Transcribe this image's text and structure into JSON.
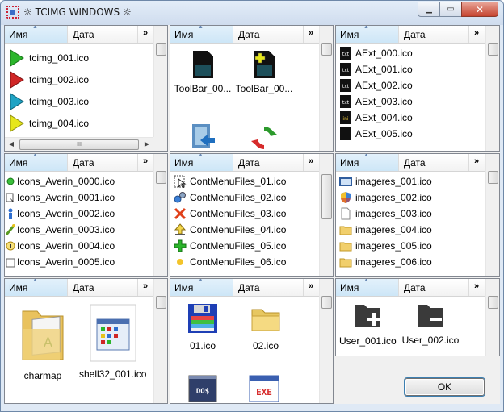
{
  "window": {
    "title": "☼ TCIMG WINDOWS ☼"
  },
  "header": {
    "name": "Имя",
    "date": "Дата",
    "more": "»"
  },
  "panes": {
    "p1": [
      "tcimg_001.ico",
      "tcimg_002.ico",
      "tcimg_003.ico",
      "tcimg_004.ico"
    ],
    "p2": [
      "ToolBar_00...",
      "ToolBar_00..."
    ],
    "p3": [
      "AExt_000.ico",
      "AExt_001.ico",
      "AExt_002.ico",
      "AExt_003.ico",
      "AExt_004.ico",
      "AExt_005.ico"
    ],
    "p4": [
      "Icons_Averin_0000.ico",
      "Icons_Averin_0001.ico",
      "Icons_Averin_0002.ico",
      "Icons_Averin_0003.ico",
      "Icons_Averin_0004.ico",
      "Icons_Averin_0005.ico"
    ],
    "p5": [
      "ContMenuFiles_01.ico",
      "ContMenuFiles_02.ico",
      "ContMenuFiles_03.ico",
      "ContMenuFiles_04.ico",
      "ContMenuFiles_05.ico",
      "ContMenuFiles_06.ico"
    ],
    "p6": [
      "imageres_001.ico",
      "imageres_002.ico",
      "imageres_003.ico",
      "imageres_004.ico",
      "imageres_005.ico",
      "imageres_006.ico"
    ],
    "p7": [
      "charmap",
      "shell32_001.ico"
    ],
    "p8": [
      "01.ico",
      "02.ico"
    ],
    "p9": [
      "User_001.ico",
      "User_002.ico"
    ]
  },
  "icon_text": {
    "txt": "txt",
    "ini": "ini",
    "dos": "DO$",
    "exe": "EXE"
  },
  "buttons": {
    "ok": "OK"
  },
  "scroll": {
    "grip": "III"
  },
  "colors": {
    "title_bg": "#cfdcee",
    "header_sorted": "#cde6f7",
    "close": "#c5432f"
  }
}
